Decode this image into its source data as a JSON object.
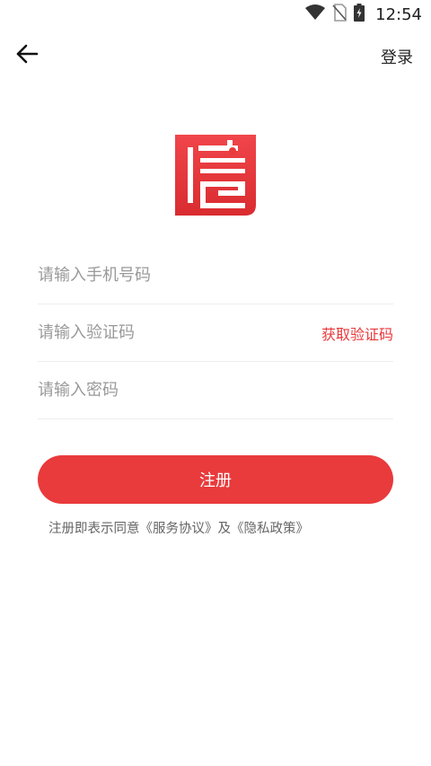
{
  "status": {
    "time": "12:54",
    "icons": [
      "wifi-icon",
      "no-sim-icon",
      "battery-charging-icon"
    ]
  },
  "nav": {
    "back_icon": "arrow-left-icon",
    "login_label": "登录"
  },
  "brand": {
    "logo_icon": "app-logo-icon",
    "accent_color": "#e93a3c"
  },
  "form": {
    "phone_placeholder": "请输入手机号码",
    "code_placeholder": "请输入验证码",
    "get_code_label": "获取验证码",
    "password_placeholder": "请输入密码"
  },
  "register": {
    "button_label": "注册"
  },
  "agreement": {
    "prefix": "注册即表示同意",
    "service_link": "《服务协议》",
    "connector": "及",
    "privacy_link": "《隐私政策》"
  }
}
